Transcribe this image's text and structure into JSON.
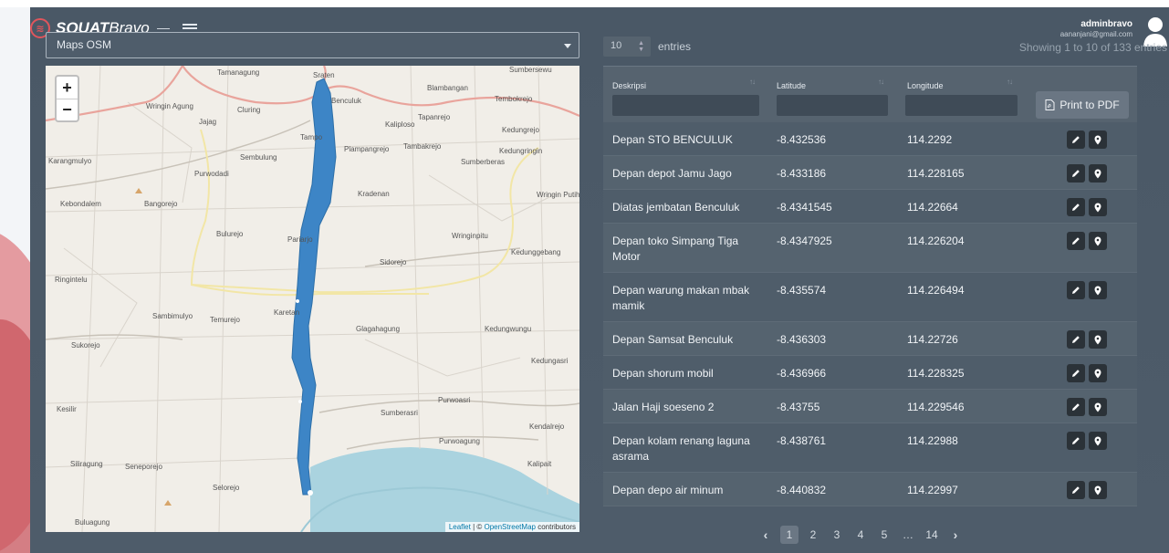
{
  "brand": {
    "name_bold": "SQUAT",
    "name_light": "Bravo"
  },
  "map_select": {
    "value": "Maps OSM"
  },
  "map": {
    "zoom_in": "+",
    "zoom_out": "−",
    "attribution_leaflet": "Leaflet",
    "attribution_sep": " | © ",
    "attribution_osm": "OpenStreetMap",
    "attribution_tail": " contributors",
    "place_labels": [
      "Tamanagung",
      "Sraten",
      "Sumbersewu",
      "Blambangan",
      "Tembokrejo",
      "Wringin Agung",
      "Cluring",
      "Benculuk",
      "Kaliploso",
      "Tapanrejo",
      "Jajag",
      "Tampo",
      "Plampangrejo",
      "Tambakrejo",
      "Kedungrejo",
      "Kedungringin",
      "Karangmulyo",
      "Sembulung",
      "Purwodadi",
      "Sumberberas",
      "Wringin Putih",
      "Kradenan",
      "Kebondalem",
      "Bangorejo",
      "Bulurejo",
      "Pariarjo",
      "Wringinpitu",
      "Kedunggebang",
      "Sidorejo",
      "Ringintelu",
      "Karetan",
      "Sambimulyo",
      "Temurejo",
      "Glagahagung",
      "Kedungwungu",
      "Sukorejo",
      "Kedungasri",
      "Purwoasri",
      "Kesilir",
      "Sumberasri",
      "Kendalrejo",
      "Purwoagung",
      "Siliragung",
      "Seneporejo",
      "Kalipait",
      "Selorejo",
      "Buluagung"
    ]
  },
  "entries": {
    "value": "10",
    "label": "entries"
  },
  "user": {
    "name": "adminbravo",
    "email": "aananjani@gmail.com"
  },
  "showing": "Showing 1 to 10 of 133 entries",
  "table": {
    "headers": [
      "Deskripsi",
      "Latitude",
      "Longitude"
    ],
    "print_label": "Print to PDF",
    "rows": [
      {
        "desc": "Depan STO BENCULUK",
        "lat": "-8.432536",
        "lng": "114.2292"
      },
      {
        "desc": "Depan depot Jamu Jago",
        "lat": "-8.433186",
        "lng": "114.228165"
      },
      {
        "desc": "Diatas jembatan Benculuk",
        "lat": "-8.4341545",
        "lng": "114.22664"
      },
      {
        "desc": "Depan toko Simpang Tiga Motor",
        "lat": "-8.4347925",
        "lng": "114.226204"
      },
      {
        "desc": "Depan warung makan mbak mamik",
        "lat": "-8.435574",
        "lng": "114.226494"
      },
      {
        "desc": "Depan Samsat Benculuk",
        "lat": "-8.436303",
        "lng": "114.22726"
      },
      {
        "desc": "Depan shorum mobil",
        "lat": "-8.436966",
        "lng": "114.228325"
      },
      {
        "desc": "Jalan Haji soeseno 2",
        "lat": "-8.43755",
        "lng": "114.229546"
      },
      {
        "desc": "Depan kolam renang laguna asrama",
        "lat": "-8.438761",
        "lng": "114.22988"
      },
      {
        "desc": "Depan depo air minum",
        "lat": "-8.440832",
        "lng": "114.22997"
      }
    ]
  },
  "pagination": {
    "prev": "‹",
    "pages": [
      "1",
      "2",
      "3",
      "4",
      "5",
      "…",
      "14"
    ],
    "next": "›",
    "active": "1"
  },
  "icons": {
    "edit": "pencil-icon",
    "locate": "map-marker-icon",
    "pdf": "pdf-file-icon",
    "user": "user-avatar-icon"
  },
  "colors": {
    "accent": "#e0555c",
    "marker": "#3d85c6",
    "panel": "#4a5866"
  }
}
